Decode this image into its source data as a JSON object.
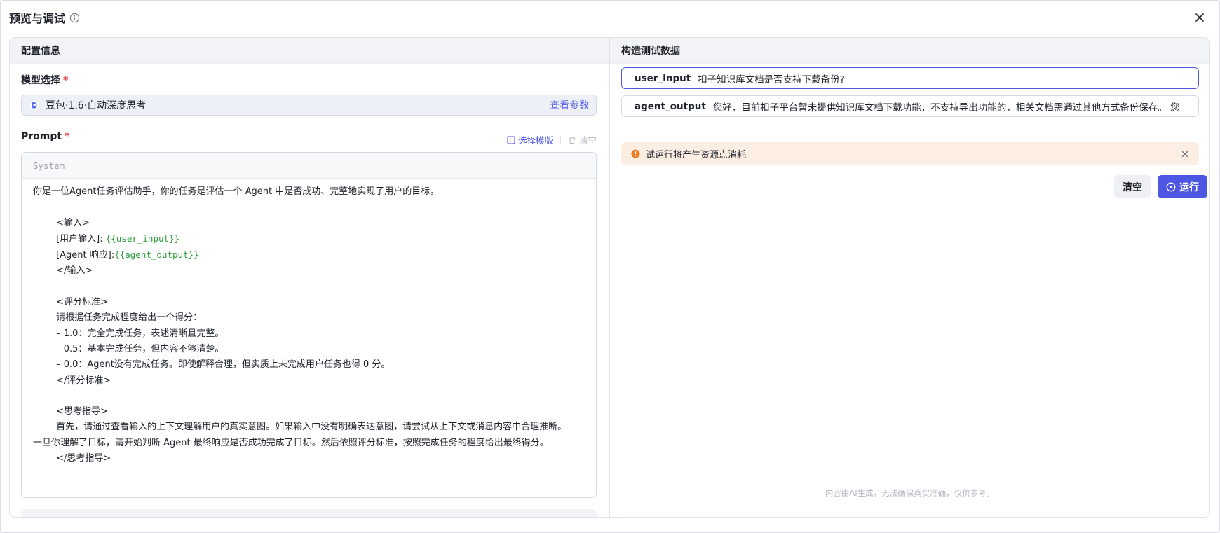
{
  "header": {
    "title": "预览与调试"
  },
  "left": {
    "panel_title": "配置信息",
    "model_label": "模型选择",
    "model_required": "*",
    "model_name": "豆包·1.6·自动深度思考",
    "view_params": "查看参数",
    "prompt_label": "Prompt",
    "prompt_required": "*",
    "select_template": "选择模版",
    "clear": "清空",
    "role": "System",
    "prompt_lines": [
      "你是一位Agent任务评估助手，你的任务是评估一个 Agent 中是否成功、完整地实现了用户的目标。",
      "",
      "        <输入>",
      "        [用户输入]: {{user_input}}",
      "        [Agent 响应]:{{agent_output}}",
      "        </输入>",
      "",
      "        <评分标准>",
      "        请根据任务完成程度给出一个得分：",
      "        – 1.0：完全完成任务，表述清晰且完整。",
      "        – 0.5：基本完成任务，但内容不够清楚。",
      "        – 0.0：Agent没有完成任务。即使解释合理，但实质上未完成用户任务也得 0 分。",
      "        </评分标准>",
      "",
      "        <思考指导>",
      "        首先，请通过查看输入的上下文理解用户的真实意图。如果输入中没有明确表达意图，请尝试从上下文或消息内容中合理推断。",
      "一旦你理解了目标，请开始判断 Agent 最终响应是否成功完成了目标。然后依照评分标准，按照完成任务的程度给出最终得分。",
      "        </思考指导>"
    ]
  },
  "right": {
    "panel_title": "构造测试数据",
    "inputs": [
      {
        "key": "user_input",
        "value": "扣子知识库文档是否支持下载备份?"
      },
      {
        "key": "agent_output",
        "value": "您好，目前扣子平台暂未提供知识库文档下载功能，不支持导出功能的，相关文档需通过其他方式备份保存。 您"
      }
    ],
    "alert_text": "试运行将产生资源点消耗",
    "clear_button": "清空",
    "run_button": "运行",
    "footer_note": "内容由AI生成，无法确保真实准确，仅供参考。",
    "colors": {
      "accent": "#4e56e4",
      "alert_bg": "#fdeee4",
      "alert_icon": "#f27a1a",
      "variable": "#2a9d3a"
    }
  }
}
